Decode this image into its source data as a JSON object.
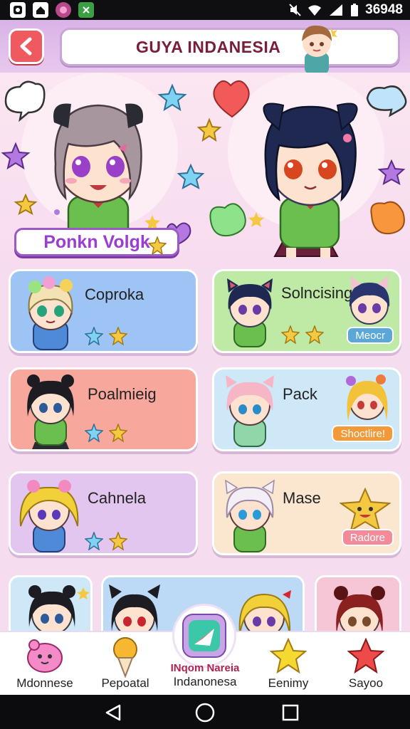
{
  "status_bar": {
    "time": "36948"
  },
  "header": {
    "title": "GUYA INDANESIA"
  },
  "hero": {
    "name": "Ponkn Volgk"
  },
  "cards": [
    {
      "name": "Coproka",
      "badge": "",
      "bg": "#9ec3f5"
    },
    {
      "name": "Solncising",
      "badge": "Meocr",
      "bg": "#bfeaa6"
    },
    {
      "name": "Poalmieig",
      "badge": "",
      "bg": "#f7a79c"
    },
    {
      "name": "Pack",
      "badge": "Shoctlire!",
      "bg": "#cfe8f8"
    },
    {
      "name": "Cahnela",
      "badge": "",
      "bg": "#e3c6ef"
    },
    {
      "name": "Mase",
      "badge": "Radore",
      "bg": "#fbe7cf"
    }
  ],
  "bottom_nav": [
    {
      "label": "Mdonnese",
      "icon": "pink-blob-icon"
    },
    {
      "label": "Pepoatal",
      "icon": "ice-cream-icon"
    },
    {
      "label": "Indanonesa",
      "icon": "app-logo-icon",
      "title": "INqom Nareia"
    },
    {
      "label": "Eenimy",
      "icon": "yellow-star-icon"
    },
    {
      "label": "Sayoo",
      "icon": "red-star-icon"
    }
  ],
  "colors": {
    "accent": "#9b3dd0",
    "back_button": "#ee5a5f",
    "title_text": "#7a1d3a"
  }
}
